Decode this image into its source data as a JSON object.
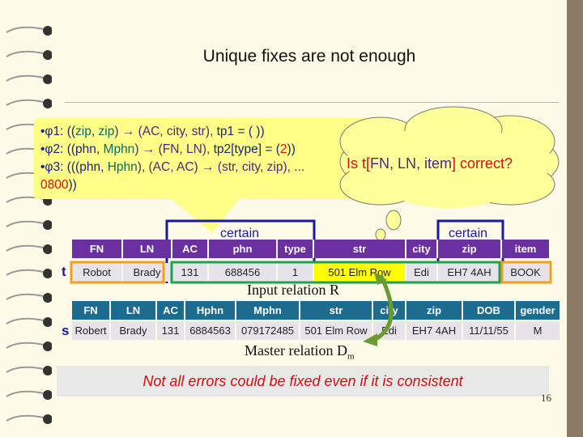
{
  "title": "Unique fixes are not enough",
  "rules": {
    "phi1": {
      "label": "•φ1",
      "p1": ": ((",
      "a": "zip",
      "p2": ", ",
      "b": "zip",
      "p3": ") → (AC, city, str), ",
      "tp": "tp1 = ( ))"
    },
    "phi2": {
      "label": "•φ2",
      "p1": ": ((phn, ",
      "b": "Mphn",
      "p3": ") → (FN, LN), ",
      "tp": "tp2[type] = (",
      "val": "2",
      "end": "))"
    },
    "phi3": {
      "label": "•φ3",
      "p1": ": (((phn, ",
      "b": "Hphn",
      "p3": "), (AC, AC) → (str, city, zip), ...",
      "val": "0800",
      "end": "))"
    }
  },
  "cloud_text": {
    "pre": "Is t[",
    "fields": "FN, LN, item",
    "post": "] correct?"
  },
  "certain_label": "certain",
  "input_relation": {
    "tuple": "t",
    "label": "Input relation R",
    "headers": [
      "FN",
      "LN",
      "AC",
      "phn",
      "type",
      "str",
      "city",
      "zip",
      "item"
    ],
    "row": [
      "Robot",
      "Brady",
      "131",
      "688456",
      "1",
      "501 Elm Row",
      "Edi",
      "EH7 4AH",
      "BOOK"
    ]
  },
  "master_relation": {
    "tuple": "s",
    "label": "Master relation D",
    "label_sub": "m",
    "headers": [
      "FN",
      "LN",
      "AC",
      "Hphn",
      "Mphn",
      "str",
      "city",
      "zip",
      "DOB",
      "gender"
    ],
    "row": [
      "Robert",
      "Brady",
      "131",
      "6884563",
      "079172485",
      "501 Elm Row",
      "Edi",
      "EH7 4AH",
      "11/11/55",
      "M"
    ]
  },
  "note": "Not all errors could be fixed even if it is consistent",
  "page_number": "16",
  "colors": {
    "input_header": "#6a2fa0",
    "master_header": "#1d6b8f",
    "highlight": "#ffff00",
    "certain_box": "#1a1aa0",
    "lhs_box": "#20a050",
    "rhs_box": "#f0a020"
  }
}
